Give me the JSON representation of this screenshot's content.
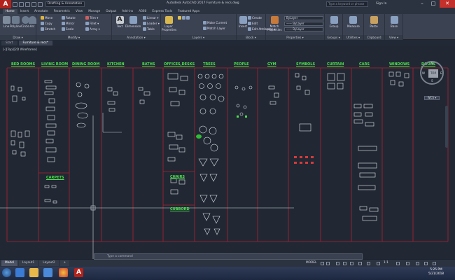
{
  "titlebar": {
    "workspace": "Drafting & Annotation",
    "doc_title": "Autodesk AutoCAD 2017   Furniture & recs.dwg",
    "search_placeholder": "Type a keyword or phrase",
    "signin": "Sign In",
    "min": "–",
    "max": "□",
    "close": "✕"
  },
  "ribbon_tabs": [
    "Home",
    "Insert",
    "Annotate",
    "Parametric",
    "View",
    "Manage",
    "Output",
    "Add-ins",
    "A360",
    "Express Tools",
    "Featured Apps"
  ],
  "ribbon": {
    "draw": {
      "title": "Draw ▾",
      "line": "Line",
      "polyline": "Polyline",
      "circle": "Circle",
      "arc": "Arc"
    },
    "modify": {
      "title": "Modify ▾",
      "move": "Move",
      "copy": "Copy",
      "stretch": "Stretch",
      "rotate": "Rotate",
      "mirror": "Mirror",
      "scale": "Scale",
      "trim": "Trim ▾",
      "fillet": "Fillet ▾",
      "array": "Array ▾"
    },
    "annotation": {
      "title": "Annotation ▾",
      "text": "Text",
      "dimension": "Dimension",
      "linear": "Linear ▾",
      "leader": "Leader ▾",
      "table": "Table"
    },
    "layers": {
      "title": "Layers ▾",
      "layer_properties": "Layer Properties",
      "make_current": "Make Current",
      "match_layer": "Match Layer"
    },
    "block": {
      "title": "Block ▾",
      "insert": "Insert",
      "create": "Create",
      "edit": "Edit",
      "edit_attributes": "Edit Attributes ▾"
    },
    "properties": {
      "title": "Properties ▾",
      "match": "Match Properties",
      "bylayer1": "ByLayer",
      "bylayer2": "—— ByLayer",
      "bylayer3": "—— ByLayer"
    },
    "groups": {
      "title": "Groups ▾",
      "group": "Group"
    },
    "utilities": {
      "title": "Utilities ▾",
      "measure": "Measure"
    },
    "clipboard": {
      "title": "Clipboard",
      "paste": "Paste"
    },
    "view": {
      "title": "View ▾",
      "base": "Base"
    }
  },
  "file_tabs": [
    "Start",
    "Furniture & recs*"
  ],
  "viewport_label": "[-][Top][2D Wireframe]",
  "columns": [
    "BED ROOMS",
    "LIVING ROOM",
    "DINING ROOM",
    "KITCHEN",
    "BATHS",
    "OFFICES,DESKS",
    "TREES",
    "PEOPLE",
    "GYM",
    "SYMBOLS",
    "CURTAIN",
    "CARS",
    "WINDOWS",
    "DOORS"
  ],
  "subheads": {
    "carpets": "CARPETS",
    "chairs": "CHAIRS",
    "cubbord": "CUBBORD"
  },
  "viewcube": {
    "top": "TOP",
    "n": "N",
    "w": "W",
    "s": "S",
    "e": "E",
    "wcs": "WCS ▾"
  },
  "command_placeholder": "Type a command",
  "layout_tabs": [
    "Model",
    "Layout1",
    "Layout2",
    "+"
  ],
  "status": {
    "model": "MODEL",
    "scale": "1:1"
  },
  "clock": {
    "time": "5:25 PM",
    "date": "5/21/2018"
  },
  "colors": {
    "accent_green": "#4be04b",
    "border_red": "#b0202e",
    "bg": "#212834"
  }
}
